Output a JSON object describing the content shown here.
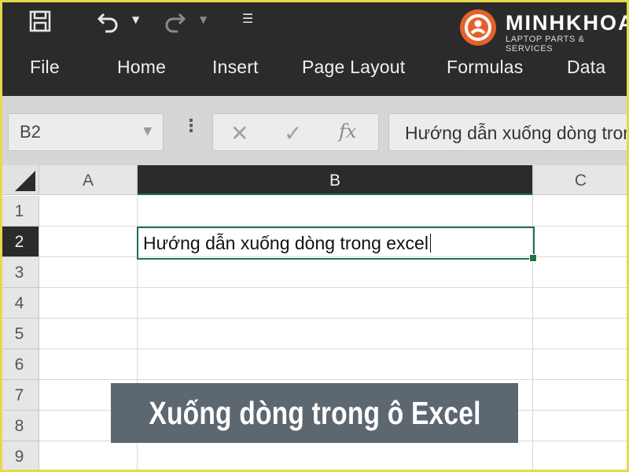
{
  "quick_access": {
    "icons": [
      "save-icon",
      "undo-icon",
      "redo-icon",
      "customize-icon"
    ]
  },
  "ribbon": {
    "tabs": [
      "File",
      "Home",
      "Insert",
      "Page Layout",
      "Formulas",
      "Data"
    ]
  },
  "logo": {
    "name": "MINHKHOA",
    "tagline": "LAPTOP PARTS & SERVICES"
  },
  "formula_bar": {
    "name_box": "B2",
    "fx_label": "fx",
    "value": "Hướng dẫn xuống dòng trong excel"
  },
  "sheet": {
    "columns": [
      "A",
      "B",
      "C"
    ],
    "rows": [
      "1",
      "2",
      "3",
      "4",
      "5",
      "6",
      "7",
      "8",
      "9"
    ],
    "active_cell": "B2",
    "active_text": "Hướng dẫn xuống dòng trong excel"
  },
  "caption": "Xuống dòng trong ô Excel",
  "colors": {
    "ribbon": "#2b2b2b",
    "accent": "#217346",
    "logo": "#e5612a",
    "caption_bg": "#5d6770"
  }
}
